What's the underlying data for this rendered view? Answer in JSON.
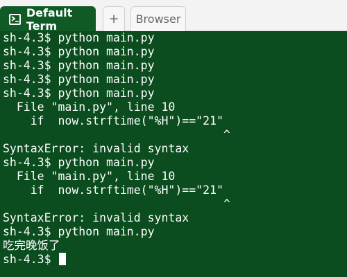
{
  "tabs": {
    "active": {
      "label": "Default Term",
      "icon": "terminal-icon"
    },
    "add_label": "+",
    "browser_label": "Browser"
  },
  "terminal": {
    "background": "#0b4d1f",
    "lines": [
      "sh-4.3$ python main.py",
      "sh-4.3$ python main.py",
      "sh-4.3$ python main.py",
      "sh-4.3$ python main.py",
      "sh-4.3$ python main.py",
      "  File \"main.py\", line 10",
      "    if  now.strftime(\"%H\")==\"21\"",
      "                                ^",
      "SyntaxError: invalid syntax",
      "sh-4.3$ python main.py",
      "  File \"main.py\", line 10",
      "    if  now.strftime(\"%H\")==\"21\"",
      "                                ^",
      "SyntaxError: invalid syntax",
      "sh-4.3$ python main.py",
      "吃完晚饭了"
    ],
    "prompt": "sh-4.3$"
  }
}
